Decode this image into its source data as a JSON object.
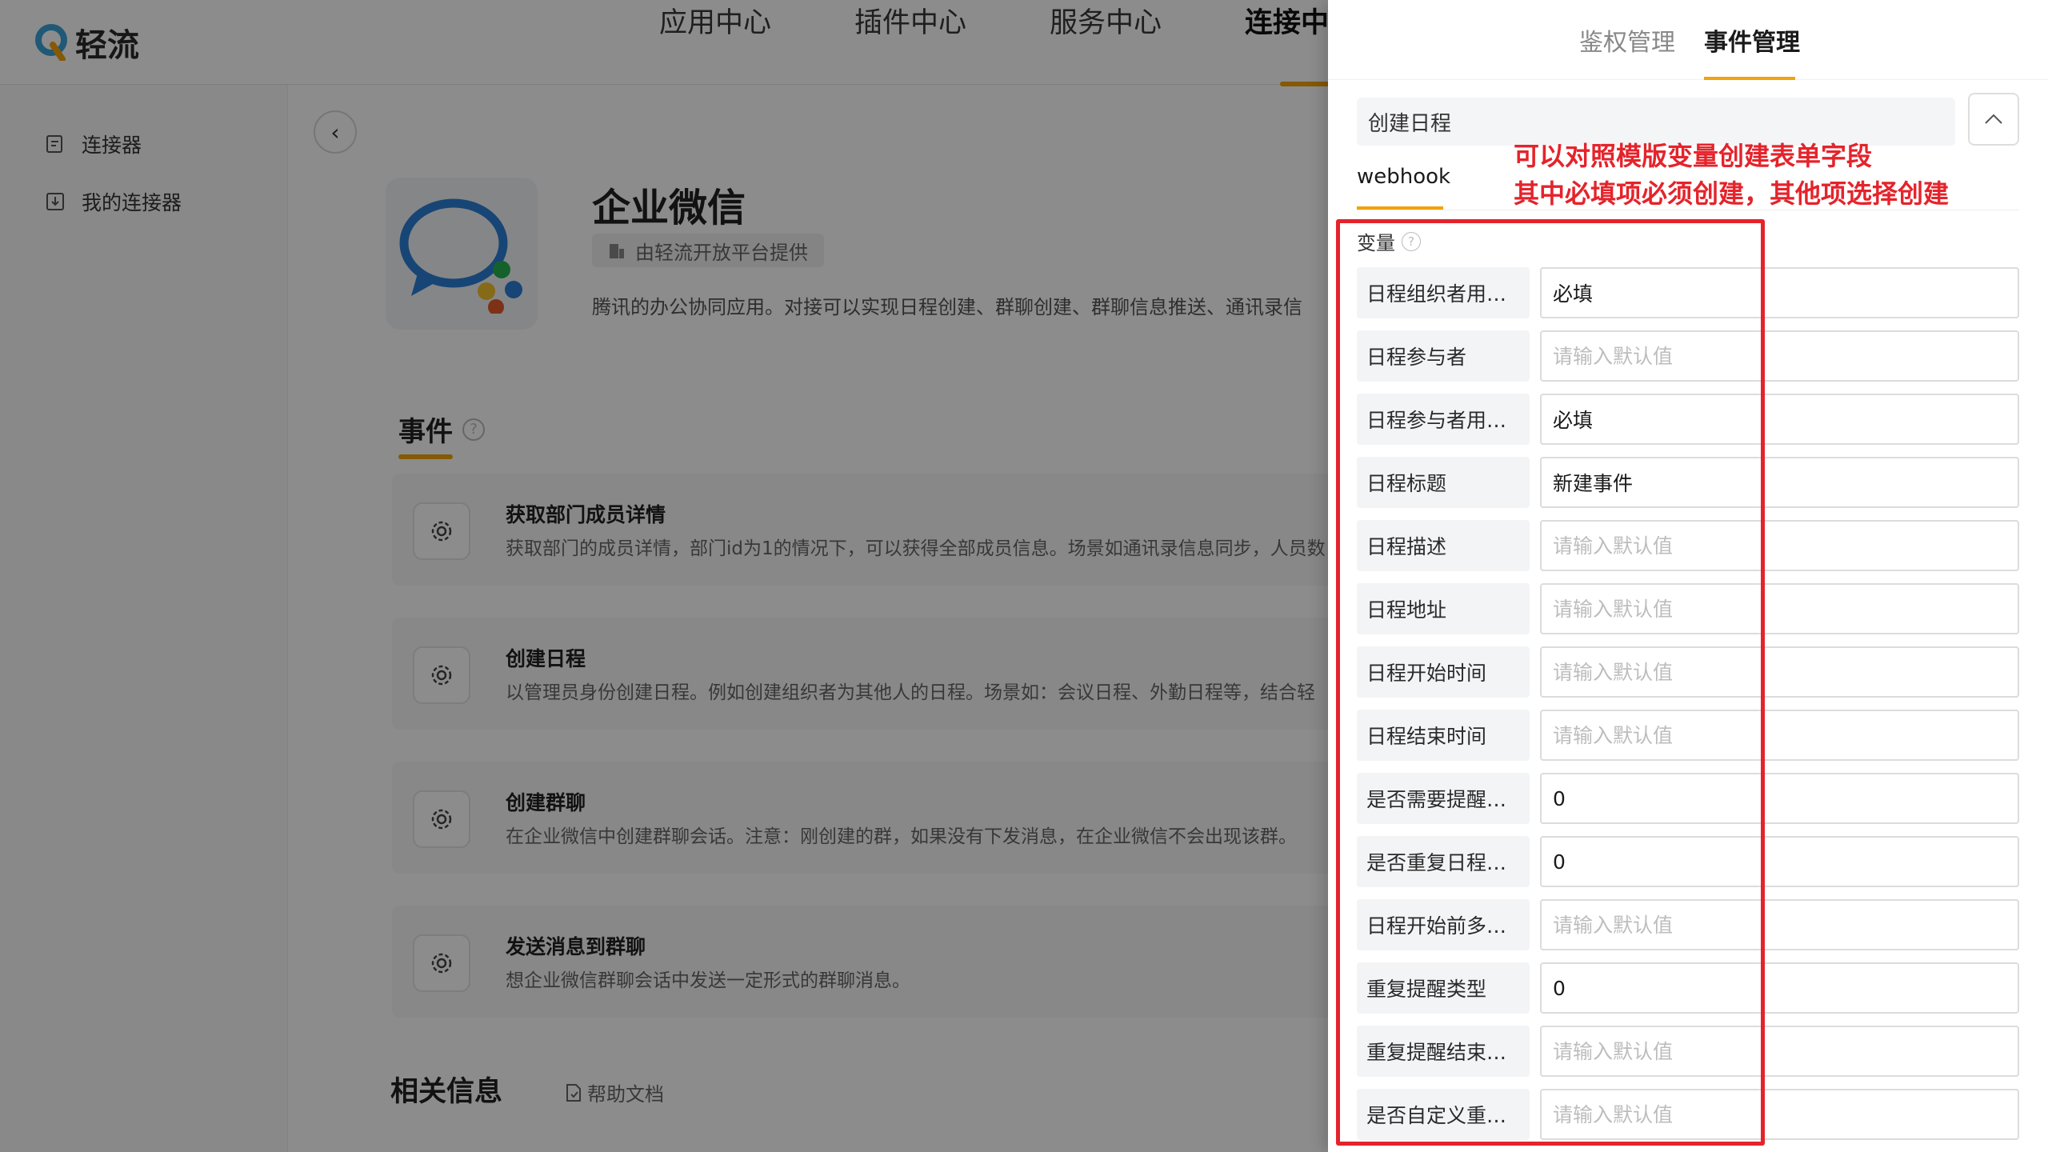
{
  "app": {
    "logo_text": "轻流",
    "nav": [
      "应用中心",
      "插件中心",
      "服务中心",
      "连接中"
    ],
    "sidebar": [
      "连接器",
      "我的连接器"
    ],
    "app_name": "企业微信",
    "provider": "由轻流开放平台提供",
    "description": "腾讯的办公协同应用。对接可以实现日程创建、群聊创建、群聊信息推送、通讯录信",
    "events_title": "事件",
    "events": [
      {
        "title": "获取部门成员详情",
        "desc": "获取部门的成员详情，部门id为1的情况下，可以获得全部成员信息。场景如通讯录信息同步，人员数"
      },
      {
        "title": "创建日程",
        "desc": "以管理员身份创建日程。例如创建组织者为其他人的日程。场景如：会议日程、外勤日程等，结合轻"
      },
      {
        "title": "创建群聊",
        "desc": "在企业微信中创建群聊会话。注意：刚创建的群，如果没有下发消息，在企业微信不会出现该群。"
      },
      {
        "title": "发送消息到群聊",
        "desc": "想企业微信群聊会话中发送一定形式的群聊消息。"
      }
    ],
    "related_title": "相关信息",
    "help_doc": "帮助文档"
  },
  "drawer": {
    "tabs": [
      "鉴权管理",
      "事件管理"
    ],
    "selected_event": "创建日程",
    "subtab": "webhook",
    "annotation": [
      "可以对照模版变量创建表单字段",
      "其中必填项必须创建，其他项选择创建"
    ],
    "vars_label": "变量",
    "placeholder": "请输入默认值",
    "variables": [
      {
        "name": "日程组织者用…",
        "value": "必填"
      },
      {
        "name": "日程参与者",
        "value": ""
      },
      {
        "name": "日程参与者用…",
        "value": "必填"
      },
      {
        "name": "日程标题",
        "value": "新建事件"
      },
      {
        "name": "日程描述",
        "value": ""
      },
      {
        "name": "日程地址",
        "value": ""
      },
      {
        "name": "日程开始时间",
        "value": ""
      },
      {
        "name": "日程结束时间",
        "value": ""
      },
      {
        "name": "是否需要提醒…",
        "value": "0"
      },
      {
        "name": "是否重复日程…",
        "value": "0"
      },
      {
        "name": "日程开始前多…",
        "value": ""
      },
      {
        "name": "重复提醒类型",
        "value": "0"
      },
      {
        "name": "重复提醒结束…",
        "value": ""
      },
      {
        "name": "是否自定义重…",
        "value": ""
      }
    ]
  },
  "colors": {
    "accent": "#f2a20c",
    "annotation": "#e5232b",
    "overlay": "rgba(0,0,0,0.45)"
  }
}
